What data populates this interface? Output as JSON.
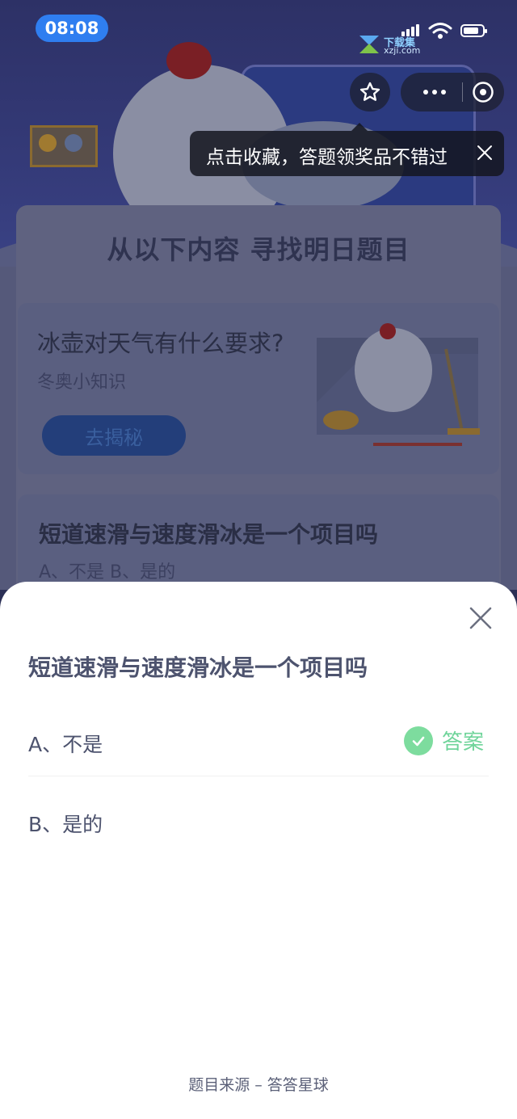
{
  "status_bar": {
    "time": "08:08"
  },
  "watermark": {
    "name": "下载集",
    "domain": "xzji.com"
  },
  "toolbar": {
    "favorite_icon": "star-icon",
    "more_icon": "more-dots-icon",
    "close_icon": "close-circle-icon"
  },
  "tooltip": {
    "text": "点击收藏，答题领奖品不错过",
    "close_icon": "close-icon"
  },
  "panel": {
    "title": "从以下内容 寻找明日题目",
    "cards": [
      {
        "question": "冰壶对天气有什么要求?",
        "subtitle": "冬奥小知识",
        "button_label": "去揭秘"
      },
      {
        "question": "短道速滑与速度滑冰是一个项目吗",
        "options_line": "A、不是    B、是的"
      }
    ]
  },
  "sheet": {
    "question": "短道速滑与速度滑冰是一个项目吗",
    "options": [
      {
        "label": "A、不是",
        "is_answer": true
      },
      {
        "label": "B、是的",
        "is_answer": false
      }
    ],
    "answer_label": "答案",
    "source": "题目来源 – 答答星球"
  },
  "colors": {
    "status_pill": "#2f7ef0",
    "answer_green": "#6fd49a",
    "question_text": "#4d536e"
  }
}
